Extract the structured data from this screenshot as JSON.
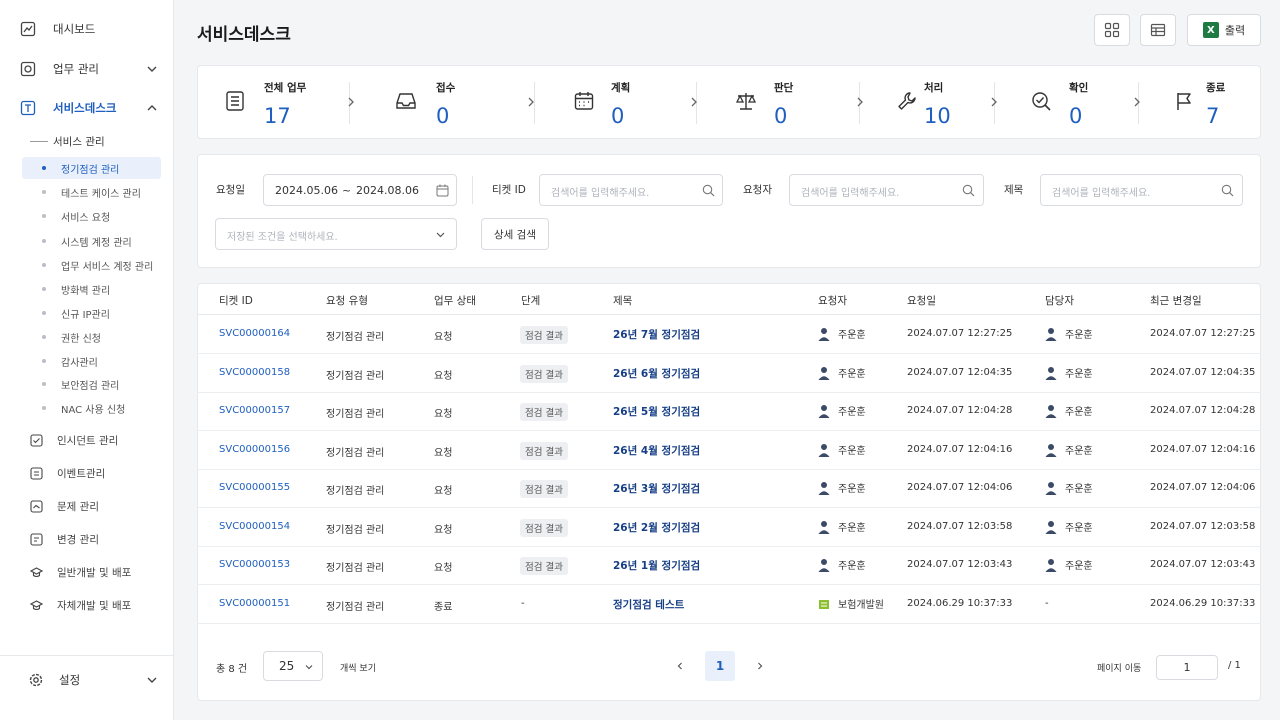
{
  "sidebar": {
    "items": [
      {
        "label": "대시보드",
        "icon": "chart-icon"
      },
      {
        "label": "업무 관리",
        "icon": "target-icon"
      },
      {
        "label": "서비스데스크",
        "icon": "text-box-icon"
      }
    ],
    "sub_header": "서비스 관리",
    "sub_items": [
      "정기점검 관리",
      "테스트 케이스 관리",
      "서비스 요청",
      "시스템 계정 관리",
      "업무 서비스 계정 관리",
      "방화벽 관리",
      "신규 IP관리",
      "권한 신청",
      "감사관리",
      "보안점검 관리",
      "NAC 사용 신청"
    ],
    "items2": [
      "인시던트 관리",
      "이벤트관리",
      "문제 관리",
      "변경 관리",
      "일반개발 및 배포",
      "자체개발 및 배포"
    ],
    "settings": "설정"
  },
  "header": {
    "title": "서비스데스크",
    "export_label": "출력",
    "excel_glyph": "X"
  },
  "stats": [
    {
      "label": "전체 업무",
      "value": "17",
      "icon": "list-icon"
    },
    {
      "label": "접수",
      "value": "0",
      "icon": "inbox-icon"
    },
    {
      "label": "계획",
      "value": "0",
      "icon": "calendar-icon"
    },
    {
      "label": "판단",
      "value": "0",
      "icon": "scale-icon"
    },
    {
      "label": "처리",
      "value": "10",
      "icon": "wrench-icon"
    },
    {
      "label": "확인",
      "value": "0",
      "icon": "check-search-icon"
    },
    {
      "label": "종료",
      "value": "7",
      "icon": "flag-icon"
    }
  ],
  "filters": {
    "date_label": "요청일",
    "date_from": "2024.05.06",
    "date_sep": "~",
    "date_to": "2024.08.06",
    "ticket_label": "티켓 ID",
    "ticket_placeholder": "검색어를 입력해주세요.",
    "requester_label": "요청자",
    "requester_placeholder": "검색어를 입력해주세요.",
    "title_label": "제목",
    "title_placeholder": "검색어를 입력해주세요.",
    "saved_placeholder": "저장된 조건을 선택하세요.",
    "detail_button": "상세 검색"
  },
  "table": {
    "columns": [
      "티켓 ID",
      "요청 유형",
      "업무 상태",
      "단계",
      "제목",
      "요청자",
      "요청일",
      "담당자",
      "최근 변경일"
    ],
    "rows": [
      {
        "id": "SVC00000164",
        "type": "정기점검 관리",
        "status": "요청",
        "stage": "점검 결과",
        "title": "26년 7월 정기점검",
        "requester": "주운훈",
        "req_date": "2024.07.07 12:27:25",
        "assignee": "주운훈",
        "updated": "2024.07.07 12:27:25"
      },
      {
        "id": "SVC00000158",
        "type": "정기점검 관리",
        "status": "요청",
        "stage": "점검 결과",
        "title": "26년 6월 정기점검",
        "requester": "주운훈",
        "req_date": "2024.07.07 12:04:35",
        "assignee": "주운훈",
        "updated": "2024.07.07 12:04:35"
      },
      {
        "id": "SVC00000157",
        "type": "정기점검 관리",
        "status": "요청",
        "stage": "점검 결과",
        "title": "26년 5월 정기점검",
        "requester": "주운훈",
        "req_date": "2024.07.07 12:04:28",
        "assignee": "주운훈",
        "updated": "2024.07.07 12:04:28"
      },
      {
        "id": "SVC00000156",
        "type": "정기점검 관리",
        "status": "요청",
        "stage": "점검 결과",
        "title": "26년 4월 정기점검",
        "requester": "주운훈",
        "req_date": "2024.07.07 12:04:16",
        "assignee": "주운훈",
        "updated": "2024.07.07 12:04:16"
      },
      {
        "id": "SVC00000155",
        "type": "정기점검 관리",
        "status": "요청",
        "stage": "점검 결과",
        "title": "26년 3월 정기점검",
        "requester": "주운훈",
        "req_date": "2024.07.07 12:04:06",
        "assignee": "주운훈",
        "updated": "2024.07.07 12:04:06"
      },
      {
        "id": "SVC00000154",
        "type": "정기점검 관리",
        "status": "요청",
        "stage": "점검 결과",
        "title": "26년 2월 정기점검",
        "requester": "주운훈",
        "req_date": "2024.07.07 12:03:58",
        "assignee": "주운훈",
        "updated": "2024.07.07 12:03:58"
      },
      {
        "id": "SVC00000153",
        "type": "정기점검 관리",
        "status": "요청",
        "stage": "점검 결과",
        "title": "26년 1월 정기점검",
        "requester": "주운훈",
        "req_date": "2024.07.07 12:03:43",
        "assignee": "주운훈",
        "updated": "2024.07.07 12:03:43"
      },
      {
        "id": "SVC00000151",
        "type": "정기점검 관리",
        "status": "종료",
        "stage": "-",
        "title": "정기점검 테스트",
        "requester": "보험개발원",
        "req_date": "2024.06.29 10:37:33",
        "assignee": "-",
        "updated": "2024.06.29 10:37:33"
      }
    ]
  },
  "pagination": {
    "total": "총 8 건",
    "page_size": "25",
    "page_size_label": "개씩 보기",
    "current_page": "1",
    "goto_label": "페이지 이동",
    "goto_value": "1",
    "total_pages": "/ 1"
  },
  "colors": {
    "accent": "#1f5fbf",
    "title_link": "#173f86",
    "excel": "#1d7a43"
  }
}
